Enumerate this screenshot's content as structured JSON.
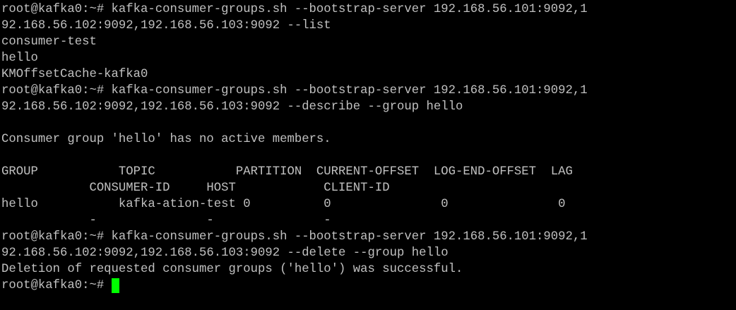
{
  "terminal": {
    "cursor_color": "#00ff00",
    "text_color": "#c0c0c0",
    "background_color": "#000000",
    "prompt": "root@kafka0:~# ",
    "lines": [
      "root@kafka0:~# kafka-consumer-groups.sh --bootstrap-server 192.168.56.101:9092,1",
      "92.168.56.102:9092,192.168.56.103:9092 --list",
      "consumer-test",
      "hello",
      "KMOffsetCache-kafka0",
      "root@kafka0:~# kafka-consumer-groups.sh --bootstrap-server 192.168.56.101:9092,1",
      "92.168.56.102:9092,192.168.56.103:9092 --describe --group hello",
      "",
      "Consumer group 'hello' has no active members.",
      "",
      "GROUP           TOPIC           PARTITION  CURRENT-OFFSET  LOG-END-OFFSET  LAG",
      "            CONSUMER-ID     HOST            CLIENT-ID",
      "hello           kafka-ation-test 0          0               0               0",
      "            -               -               -",
      "root@kafka0:~# kafka-consumer-groups.sh --bootstrap-server 192.168.56.101:9092,1",
      "92.168.56.102:9092,192.168.56.103:9092 --delete --group hello",
      "Deletion of requested consumer groups ('hello') was successful."
    ]
  }
}
